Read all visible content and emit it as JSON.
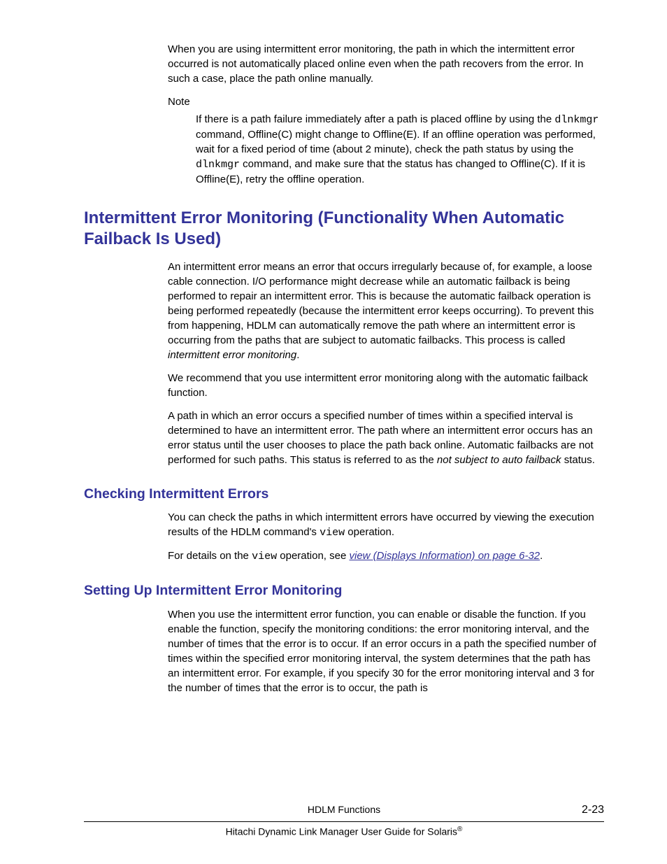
{
  "intro_para": "When you are using intermittent error monitoring, the path in which the intermittent error occurred is not automatically placed online even when the path recovers from the error. In such a case, place the path online manually.",
  "note_label": "Note",
  "note_body": {
    "pre1": "If there is a path failure immediately after a path is placed offline by using the ",
    "cmd1": "dlnkmgr",
    "mid1": " command, Offline(C) might change to Offline(E). If an offline operation was performed, wait for a fixed period of time (about 2 minute), check the path status by using the ",
    "cmd2": "dlnkmgr",
    "post1": " command, and make sure that the status has changed to Offline(C). If it is Offline(E), retry the offline operation."
  },
  "h1": "Intermittent Error Monitoring (Functionality When Automatic Failback Is Used)",
  "sec1_p1": {
    "pre": "An intermittent error means an error that occurs irregularly because of, for example, a loose cable connection. I/O performance might decrease while an automatic failback is being performed to repair an intermittent error. This is because the automatic failback operation is being performed repeatedly (because the intermittent error keeps occurring). To prevent this from happening, HDLM can automatically remove the path where an intermittent error is occurring from the paths that are subject to automatic failbacks. This process is called ",
    "it": "intermittent error monitoring",
    "post": "."
  },
  "sec1_p2": "We recommend that you use intermittent error monitoring along with the automatic failback function.",
  "sec1_p3": {
    "pre": "A path in which an error occurs a specified number of times within a specified interval is determined to have an intermittent error. The path where an intermittent error occurs has an error status until the user chooses to place the path back online. Automatic failbacks are not performed for such paths. This status is referred to as the ",
    "it": "not subject to auto failback",
    "post": " status."
  },
  "h2a": "Checking Intermittent Errors",
  "sec2_p1": {
    "pre": "You can check the paths in which intermittent errors have occurred by viewing the execution results of the HDLM command's ",
    "cmd": "view",
    "post": " operation."
  },
  "sec2_p2": {
    "pre": "For details on the ",
    "cmd": "view",
    "mid": " operation, see ",
    "link": "view (Displays Information) on page 6-32",
    "post": "."
  },
  "h2b": "Setting Up Intermittent Error Monitoring",
  "sec3_p1": "When you use the intermittent error function, you can enable or disable the function. If you enable the function, specify the monitoring conditions: the error monitoring interval, and the number of times that the error is to occur. If an error occurs in a path the specified number of times within the specified error monitoring interval, the system determines that the path has an intermittent error. For example, if you specify 30 for the error monitoring interval and 3 for the number of times that the error is to occur, the path is",
  "footer": {
    "section": "HDLM Functions",
    "page": "2-23",
    "book_pre": "Hitachi Dynamic Link Manager User Guide for Solaris",
    "reg": "®"
  }
}
